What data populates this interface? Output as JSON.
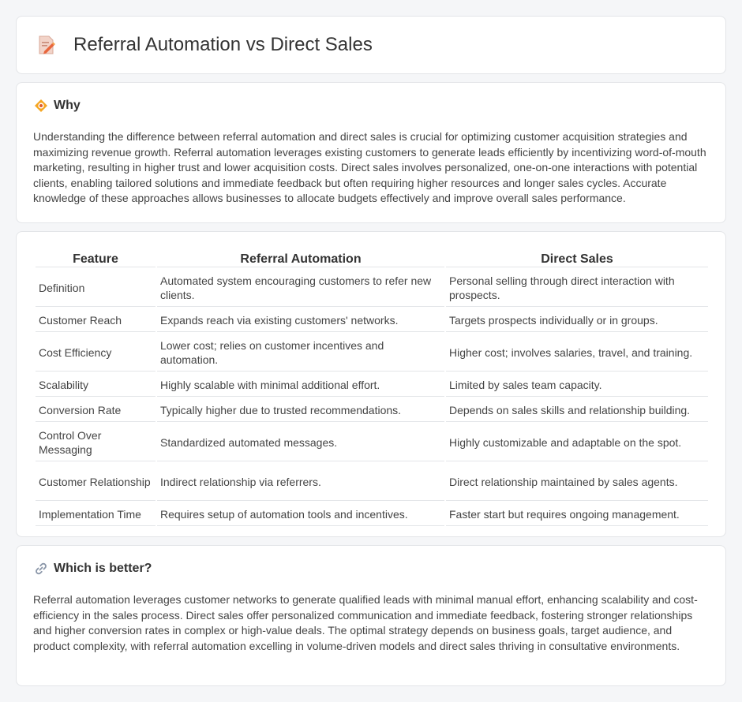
{
  "header": {
    "title": "Referral Automation vs Direct Sales",
    "icon": "document-pencil-icon"
  },
  "why": {
    "icon": "target-badge-icon",
    "title": "Why",
    "text": "Understanding the difference between referral automation and direct sales is crucial for optimizing customer acquisition strategies and maximizing revenue growth. Referral automation leverages existing customers to generate leads efficiently by incentivizing word-of-mouth marketing, resulting in higher trust and lower acquisition costs. Direct sales involves personalized, one-on-one interactions with potential clients, enabling tailored solutions and immediate feedback but often requiring higher resources and longer sales cycles. Accurate knowledge of these approaches allows businesses to allocate budgets effectively and improve overall sales performance."
  },
  "table": {
    "headers": [
      "Feature",
      "Referral Automation",
      "Direct Sales"
    ],
    "rows": [
      [
        "Definition",
        "Automated system encouraging customers to refer new clients.",
        "Personal selling through direct interaction with prospects."
      ],
      [
        "Customer Reach",
        "Expands reach via existing customers' networks.",
        "Targets prospects individually or in groups."
      ],
      [
        "Cost Efficiency",
        "Lower cost; relies on customer incentives and automation.",
        "Higher cost; involves salaries, travel, and training."
      ],
      [
        "Scalability",
        "Highly scalable with minimal additional effort.",
        "Limited by sales team capacity."
      ],
      [
        "Conversion Rate",
        "Typically higher due to trusted recommendations.",
        "Depends on sales skills and relationship building."
      ],
      [
        "Control Over Messaging",
        "Standardized automated messages.",
        "Highly customizable and adaptable on the spot."
      ],
      [
        "Customer Relationship",
        "Indirect relationship via referrers.",
        "Direct relationship maintained by sales agents."
      ],
      [
        "Implementation Time",
        "Requires setup of automation tools and incentives.",
        "Faster start but requires ongoing management."
      ]
    ]
  },
  "better": {
    "icon": "link-icon",
    "title": "Which is better?",
    "text": "Referral automation leverages customer networks to generate qualified leads with minimal manual effort, enhancing scalability and cost-efficiency in the sales process. Direct sales offer personalized communication and immediate feedback, fostering stronger relationships and higher conversion rates in complex or high-value deals. The optimal strategy depends on business goals, target audience, and product complexity, with referral automation excelling in volume-driven models and direct sales thriving in consultative environments."
  }
}
